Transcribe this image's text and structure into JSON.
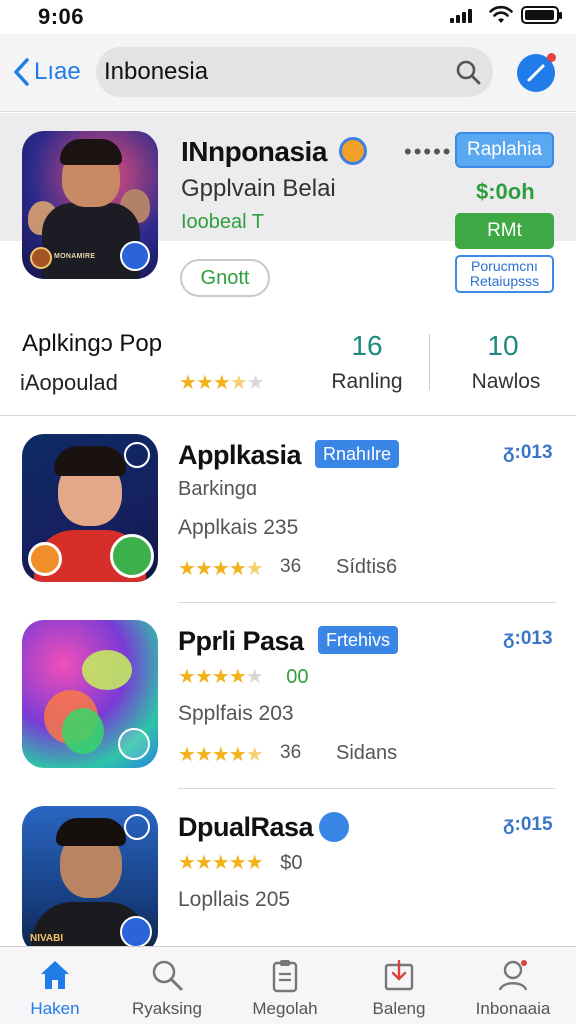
{
  "status_bar": {
    "time": "9:06"
  },
  "nav": {
    "back_label": "Lıae",
    "search_value": "Inbonesia",
    "search_placeholder": ""
  },
  "featured": {
    "title": "INnponasia",
    "subtitle": "Gpplvain Belai",
    "developer": "Ioobeal T",
    "dots": "•••••",
    "top_button": "Raplahia",
    "price": "$:0oh",
    "get_button": "RMt",
    "outline_button": "Porucmcnı Retaiupsss",
    "pill_button": "Gnott",
    "icon_caption": "MONAMIRE"
  },
  "stats": {
    "title": "Aplkingɔ Pop",
    "subtitle": "iAopoulad",
    "rating": 3.5,
    "stat1_value": "16",
    "stat1_label": "Ranling",
    "stat2_value": "10",
    "stat2_label": "Nawlos"
  },
  "apps": [
    {
      "name": "Applkasia",
      "tag": "Rnahılre",
      "num": "ᵹ:013",
      "line2": "Barkingɑ",
      "line3": "Applkais 235",
      "rating": 4.5,
      "count": "36",
      "side": "Sídtis6"
    },
    {
      "name": "Pprli Pasa",
      "tag": "Frtehivs",
      "num": "ᵹ:013",
      "line2_rating": 4,
      "line2_count": "00",
      "line3": "Spplfais 203",
      "rating": 4.5,
      "count": "36",
      "side": "Sidans"
    },
    {
      "name": "DpualRasa",
      "num": "ᵹ:015",
      "line2_rating": 5,
      "line2_count": "$0",
      "line3": "Lopllais 205",
      "icon_caption": "NIVABI"
    }
  ],
  "tabs": [
    {
      "label": "Haken",
      "icon": "home-icon",
      "active": true
    },
    {
      "label": "Ryaksing",
      "icon": "search-icon",
      "active": false
    },
    {
      "label": "Megolah",
      "icon": "clipboard-icon",
      "active": false
    },
    {
      "label": "Baleng",
      "icon": "download-icon",
      "active": false
    },
    {
      "label": "Inbonaaia",
      "icon": "profile-icon",
      "active": false
    }
  ],
  "colors": {
    "accent": "#1f7ce8",
    "green": "#2f9e3c",
    "star": "#f2b21b",
    "teal": "#1e8a7e"
  }
}
